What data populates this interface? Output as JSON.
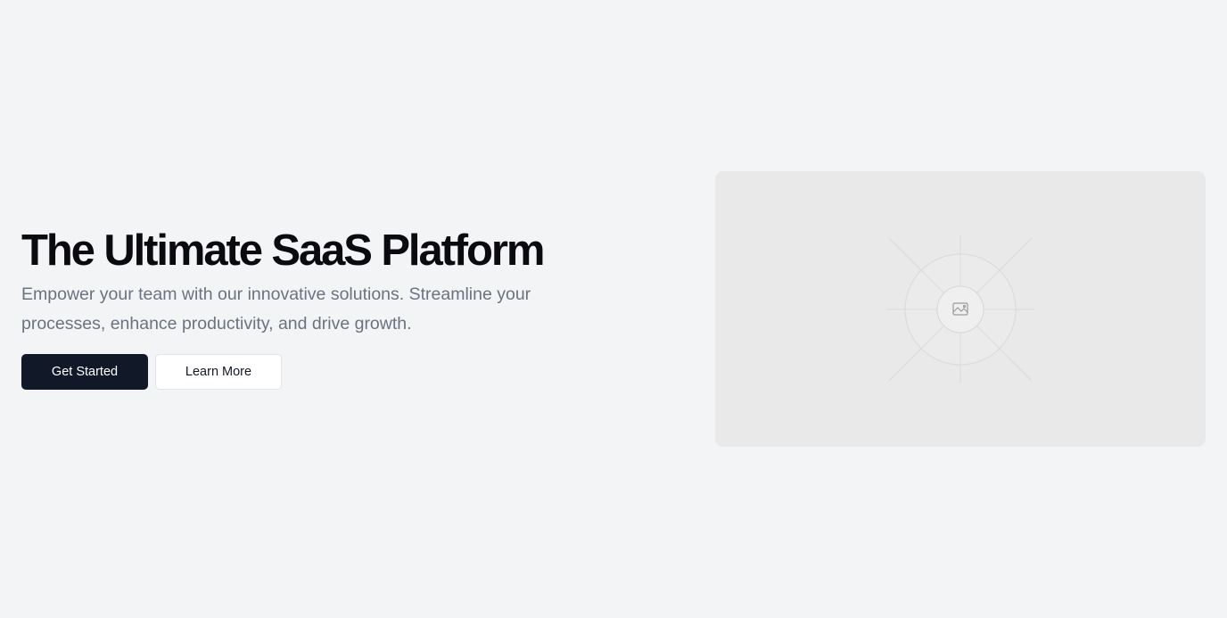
{
  "hero": {
    "title": "The Ultimate SaaS Platform",
    "subtitle": "Empower your team with our innovative solutions. Streamline your processes, enhance productivity, and drive growth.",
    "primary_button": "Get Started",
    "secondary_button": "Learn More",
    "media": {
      "icon": "image-placeholder-icon"
    }
  },
  "colors": {
    "background": "#f3f4f6",
    "title": "#0b0b0f",
    "subtitle": "#6b7280",
    "primary_button_bg": "#111827",
    "primary_button_text": "#ffffff",
    "secondary_button_bg": "#ffffff",
    "placeholder_bg": "#e9e9e9"
  }
}
